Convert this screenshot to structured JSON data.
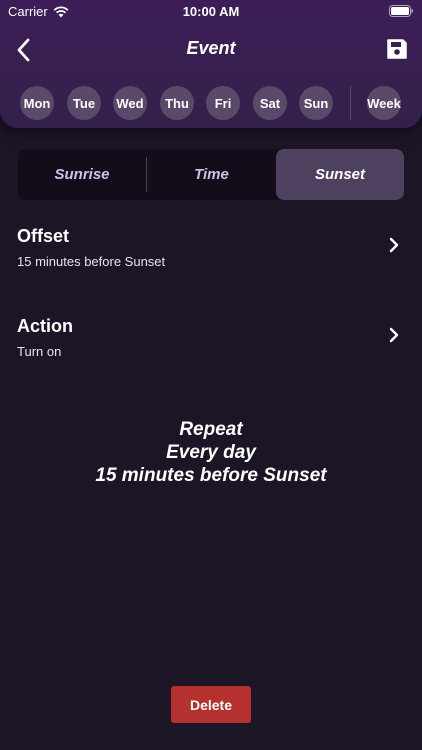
{
  "status_bar": {
    "carrier": "Carrier",
    "time": "10:00 AM"
  },
  "nav": {
    "title": "Event"
  },
  "days": [
    "Mon",
    "Tue",
    "Wed",
    "Thu",
    "Fri",
    "Sat",
    "Sun"
  ],
  "week_label": "Week",
  "segments": {
    "sunrise": "Sunrise",
    "time": "Time",
    "sunset": "Sunset",
    "selected": "Sunset"
  },
  "offset": {
    "title": "Offset",
    "value": "15 minutes before Sunset"
  },
  "action": {
    "title": "Action",
    "value": "Turn on"
  },
  "summary": {
    "line1": "Repeat",
    "line2": "Every day",
    "line3": "15 minutes before Sunset"
  },
  "delete_label": "Delete",
  "colors": {
    "background": "#1c1526",
    "header": "#3c1d57",
    "day_chip": "#5a4a6a",
    "segment_active": "#4e4160",
    "delete": "#b5312e"
  },
  "icons": {
    "back": "chevron-left-icon",
    "save": "floppy-disk-icon",
    "row": "chevron-right-icon",
    "wifi": "wifi-icon",
    "battery": "battery-icon"
  }
}
